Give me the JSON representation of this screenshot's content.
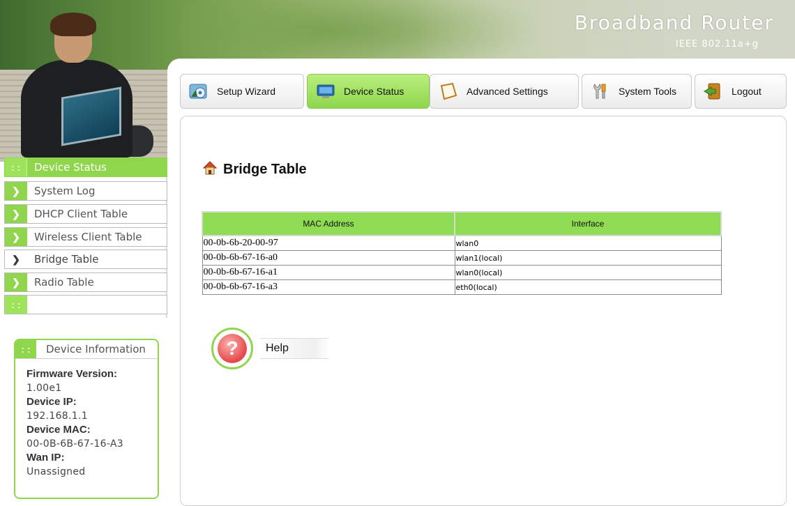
{
  "header": {
    "brand_title": "Broadband Router",
    "brand_subtitle": "IEEE 802.11a+g"
  },
  "nav": {
    "tabs": [
      {
        "label": "Setup Wizard",
        "icon": "setup-wizard-icon",
        "active": false
      },
      {
        "label": "Device Status",
        "icon": "device-status-icon",
        "active": true
      },
      {
        "label": "Advanced Settings",
        "icon": "advanced-settings-icon",
        "active": false
      },
      {
        "label": "System Tools",
        "icon": "system-tools-icon",
        "active": false
      },
      {
        "label": "Logout",
        "icon": "logout-icon",
        "active": false
      }
    ]
  },
  "sidebar": {
    "section_title": "Device Status",
    "items": [
      {
        "label": "System Log"
      },
      {
        "label": "DHCP Client Table"
      },
      {
        "label": "Wireless Client Table"
      },
      {
        "label": "Bridge Table",
        "current": true
      },
      {
        "label": "Radio Table"
      }
    ]
  },
  "device_info": {
    "title": "Device Information",
    "firmware_label": "Firmware Version:",
    "firmware_value": "1.00e1",
    "ip_label": "Device IP:",
    "ip_value": "192.168.1.1",
    "mac_label": "Device MAC:",
    "mac_value": "00-0B-6B-67-16-A3",
    "wan_label": "Wan IP:",
    "wan_value": "Unassigned"
  },
  "main": {
    "title": "Bridge Table",
    "table": {
      "headers": [
        "MAC Address",
        "Interface"
      ],
      "rows": [
        [
          "00-0b-6b-20-00-97",
          "wlan0"
        ],
        [
          "00-0b-6b-67-16-a0",
          "wlan1(local)"
        ],
        [
          "00-0b-6b-67-16-a1",
          "wlan0(local)"
        ],
        [
          "00-0b-6b-67-16-a3",
          "eth0(local)"
        ]
      ]
    },
    "help_label": "Help"
  },
  "colors": {
    "accent_green": "#8fd64d",
    "border_gray": "#8a8a8a"
  }
}
